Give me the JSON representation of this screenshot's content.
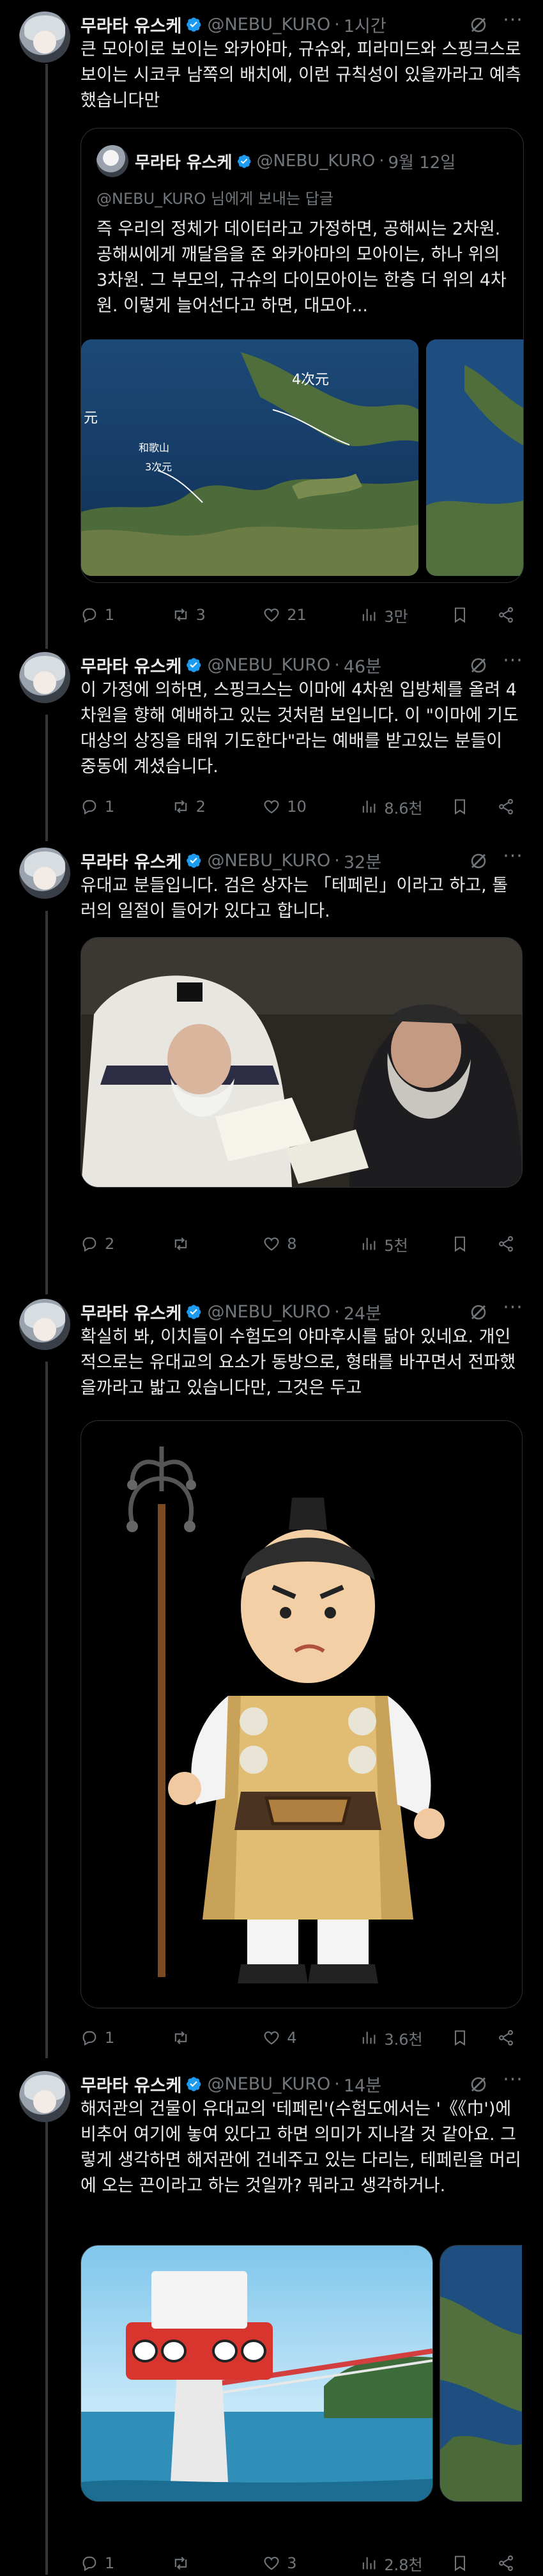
{
  "author": {
    "name": "무라타 유스케",
    "handle": "@NEBU_KURO"
  },
  "tweets": [
    {
      "time": "1시간",
      "text": "큰 모아이로 보이는 와카야마, 규슈와, 피라미드와 스핑크스로 보이는 시코쿠 남쪽의 배치에, 이런 규칙성이 있을까라고 예측했습니다만",
      "quote": {
        "time": "9월 12일",
        "reply_to": "@NEBU_KURO 님에게 보내는 답글",
        "text": "즉 우리의 정체가 데이터라고 가정하면, 공해씨는 2차원. 공해씨에게 깨달음을 준 와카야마의 모아이는, 하나 위의 3차원. 그 부모의, 규슈의 다이모아이는 한층 더 위의 4차원. 이렇게 늘어선다고 하면, 대모아...",
        "map_annotation_1": "4次元",
        "map_annotation_2a": "和歌山",
        "map_annotation_2b": "3次元",
        "map_edge_label": "元"
      },
      "stats": {
        "replies": "1",
        "reposts": "3",
        "likes": "21",
        "views": "3만"
      }
    },
    {
      "time": "46분",
      "text": "이 가정에 의하면, 스핑크스는 이마에 4차원 입방체를 올려 4차원을 향해 예배하고 있는 것처럼 보입니다. 이 \"이마에 기도 대상의 상징을 태워 기도한다\"라는 예배를 받고있는 분들이 중동에 계셨습니다.",
      "stats": {
        "replies": "1",
        "reposts": "2",
        "likes": "10",
        "views": "8.6천"
      }
    },
    {
      "time": "32분",
      "text": "유대교 분들입니다. 검은 상자는 「테페린」이라고 하고, 톨러의 일절이 들어가 있다고 합니다.",
      "stats": {
        "replies": "2",
        "reposts": "",
        "likes": "8",
        "views": "5천"
      }
    },
    {
      "time": "24분",
      "text": "확실히 봐, 이치들이 수험도의 야마후시를 닮아 있네요. 개인적으로는 유대교의 요소가 동방으로, 형태를 바꾸면서 전파했을까라고 밟고 있습니다만, 그것은 두고",
      "stats": {
        "replies": "1",
        "reposts": "",
        "likes": "4",
        "views": "3.6천"
      }
    },
    {
      "time": "14분",
      "text": "해저관의 건물이 유대교의 '테페린'(수험도에서는 '《《巾')에 비추어 여기에 놓여 있다고 하면 의미가 지나갈 것 같아요. 그렇게 생각하면 해저관에 건네주고 있는 다리는, 테페린을 머리에 오는 끈이라고 하는 것일까? 뭐라고 생각하거나.",
      "stats": {
        "replies": "1",
        "reposts": "",
        "likes": "3",
        "views": "2.8천"
      }
    }
  ],
  "icons": {
    "verified": "verified-badge-icon",
    "grok": "grok-icon",
    "more": "more-dots-icon",
    "reply": "reply-icon",
    "repost": "repost-icon",
    "like": "heart-icon",
    "views": "views-bar-icon",
    "bookmark": "bookmark-icon",
    "share": "share-icon"
  },
  "colors": {
    "background": "#000000",
    "text": "#e7e9ea",
    "muted": "#71767b",
    "verified": "#1d9bf0",
    "border": "#2f3336"
  }
}
